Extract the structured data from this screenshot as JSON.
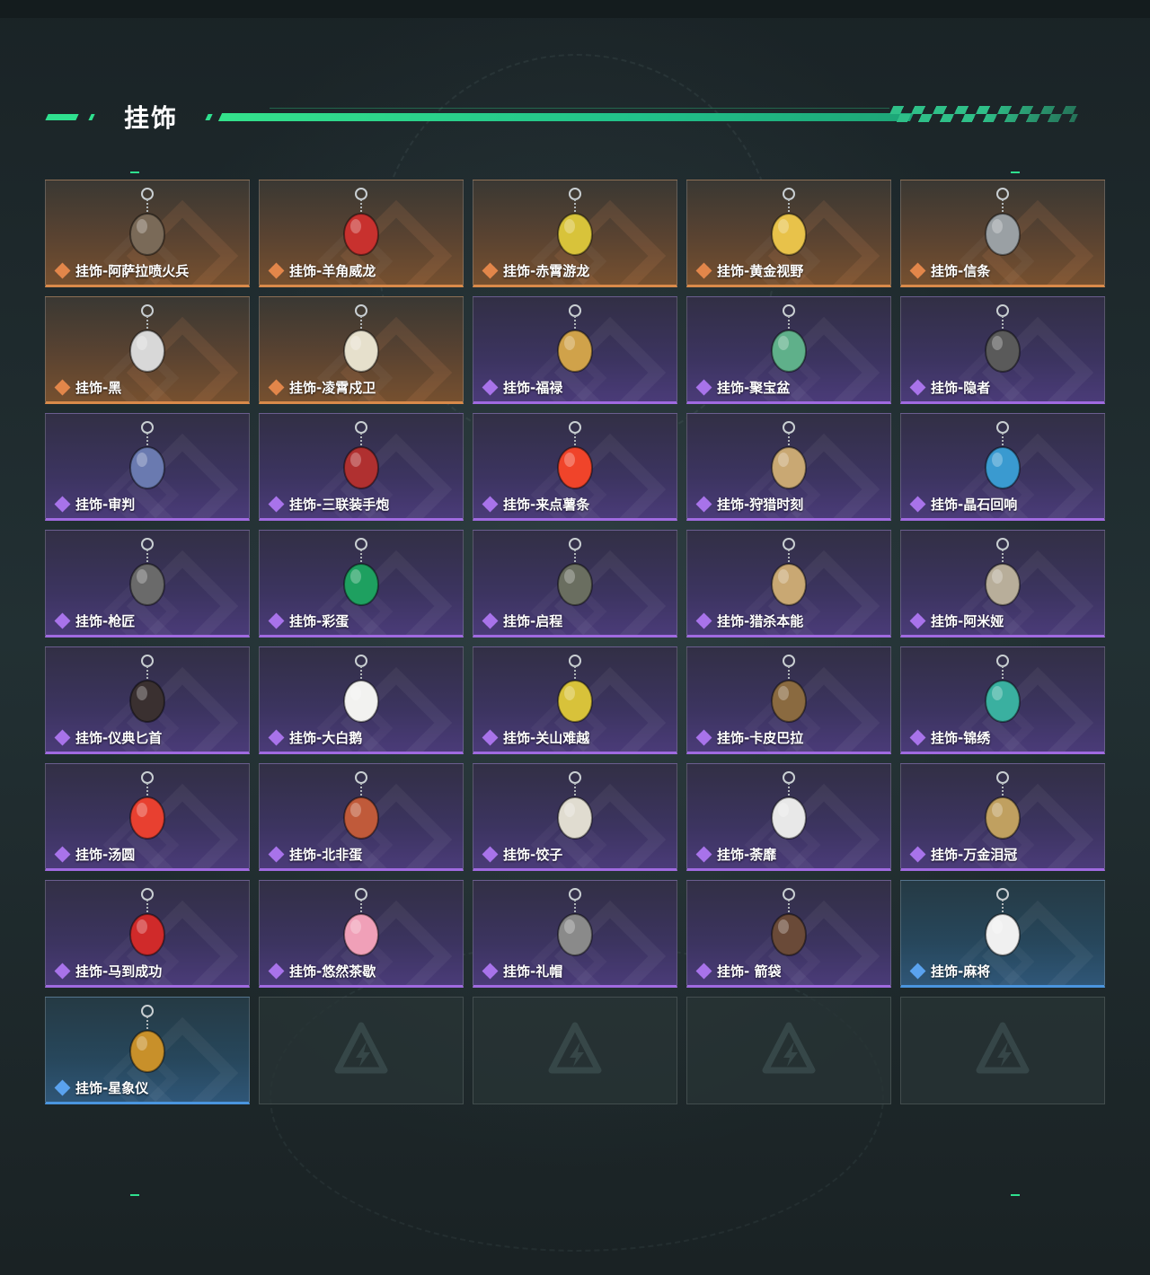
{
  "section": {
    "title": "挂饰"
  },
  "colors": {
    "accent": "#2fe08f",
    "legendary": "#d98a4a",
    "epic": "#a06ae0",
    "rare": "#4a95de"
  },
  "items": [
    {
      "label": "挂饰-阿萨拉喷火兵",
      "rarity": "orange",
      "icon": "soldier-charm-icon",
      "color": "#7a6a58"
    },
    {
      "label": "挂饰-羊角威龙",
      "rarity": "orange",
      "icon": "red-dragon-charm-icon",
      "color": "#c8312e"
    },
    {
      "label": "挂饰-赤霄游龙",
      "rarity": "orange",
      "icon": "yellow-dragon-charm-icon",
      "color": "#d8c33a"
    },
    {
      "label": "挂饰-黄金视野",
      "rarity": "orange",
      "icon": "gold-figure-charm-icon",
      "color": "#e8c24a"
    },
    {
      "label": "挂饰-信条",
      "rarity": "orange",
      "icon": "silver-charm-icon",
      "color": "#9aa0a4"
    },
    {
      "label": "挂饰-黑",
      "rarity": "orange",
      "icon": "card-charm-icon",
      "color": "#d8d8d8"
    },
    {
      "label": "挂饰-凌霄戍卫",
      "rarity": "orange",
      "icon": "eagle-charm-icon",
      "color": "#e6e0cc"
    },
    {
      "label": "挂饰-福禄",
      "rarity": "purple",
      "icon": "gourd-charm-icon",
      "color": "#d0a24a"
    },
    {
      "label": "挂饰-聚宝盆",
      "rarity": "purple",
      "icon": "treasure-bowl-charm-icon",
      "color": "#5fb08a"
    },
    {
      "label": "挂饰-隐者",
      "rarity": "purple",
      "icon": "tarot-card-charm-icon",
      "color": "#5a5a5a"
    },
    {
      "label": "挂饰-审判",
      "rarity": "purple",
      "icon": "judgement-card-charm-icon",
      "color": "#6a7ab0"
    },
    {
      "label": "挂饰-三联装手炮",
      "rarity": "purple",
      "icon": "hand-cannon-charm-icon",
      "color": "#b03030"
    },
    {
      "label": "挂饰-来点薯条",
      "rarity": "purple",
      "icon": "fries-charm-icon",
      "color": "#f0442a"
    },
    {
      "label": "挂饰-狩猎时刻",
      "rarity": "purple",
      "icon": "antler-charm-icon",
      "color": "#c9a873"
    },
    {
      "label": "挂饰-晶石回响",
      "rarity": "purple",
      "icon": "crystal-charm-icon",
      "color": "#3a9ad0"
    },
    {
      "label": "挂饰-枪匠",
      "rarity": "purple",
      "icon": "gunsmith-charm-icon",
      "color": "#6a6a6a"
    },
    {
      "label": "挂饰-彩蛋",
      "rarity": "purple",
      "icon": "green-egg-charm-icon",
      "color": "#1ea060"
    },
    {
      "label": "挂饰-启程",
      "rarity": "purple",
      "icon": "compass-ring-charm-icon",
      "color": "#6a6e60"
    },
    {
      "label": "挂饰-猎杀本能",
      "rarity": "purple",
      "icon": "antler-charm-icon",
      "color": "#c9a873"
    },
    {
      "label": "挂饰-阿米娅",
      "rarity": "purple",
      "icon": "rabbit-ears-charm-icon",
      "color": "#b8ae9a"
    },
    {
      "label": "挂饰-仪典匕首",
      "rarity": "purple",
      "icon": "dagger-charm-icon",
      "color": "#3a3030"
    },
    {
      "label": "挂饰-大白鹅",
      "rarity": "purple",
      "icon": "goose-charm-icon",
      "color": "#f2f2f0"
    },
    {
      "label": "挂饰-关山难越",
      "rarity": "purple",
      "icon": "yellow-can-charm-icon",
      "color": "#d8c23a"
    },
    {
      "label": "挂饰-卡皮巴拉",
      "rarity": "purple",
      "icon": "capybara-charm-icon",
      "color": "#8a6a40"
    },
    {
      "label": "挂饰-锦绣",
      "rarity": "purple",
      "icon": "butterfly-charm-icon",
      "color": "#3ab0a0"
    },
    {
      "label": "挂饰-汤圆",
      "rarity": "purple",
      "icon": "tangyuan-charm-icon",
      "color": "#e84030"
    },
    {
      "label": "挂饰-北非蛋",
      "rarity": "purple",
      "icon": "shakshuka-charm-icon",
      "color": "#c05a3a"
    },
    {
      "label": "挂饰-饺子",
      "rarity": "purple",
      "icon": "dumpling-charm-icon",
      "color": "#e0dcd0"
    },
    {
      "label": "挂饰-荼靡",
      "rarity": "purple",
      "icon": "flower-charm-icon",
      "color": "#e8e8e8"
    },
    {
      "label": "挂饰-万金泪冠",
      "rarity": "purple",
      "icon": "crown-burger-charm-icon",
      "color": "#c0a060"
    },
    {
      "label": "挂饰-马到成功",
      "rarity": "purple",
      "icon": "red-horse-charm-icon",
      "color": "#d02a2a"
    },
    {
      "label": "挂饰-悠然茶歇",
      "rarity": "purple",
      "icon": "cupcake-charm-icon",
      "color": "#f0a0b8"
    },
    {
      "label": "挂饰-礼帽",
      "rarity": "purple",
      "icon": "hat-charm-icon",
      "color": "#8a8a8a"
    },
    {
      "label": "挂饰- 箭袋",
      "rarity": "purple",
      "icon": "quiver-charm-icon",
      "color": "#6a4a38"
    },
    {
      "label": "挂饰-麻将",
      "rarity": "blue",
      "icon": "mahjong-charm-icon",
      "color": "#f0f0f0"
    },
    {
      "label": "挂饰-星象仪",
      "rarity": "blue",
      "icon": "astrolabe-charm-icon",
      "color": "#c8902a"
    },
    {
      "label": "",
      "rarity": "empty",
      "icon": "logo-placeholder-icon",
      "color": ""
    },
    {
      "label": "",
      "rarity": "empty",
      "icon": "logo-placeholder-icon",
      "color": ""
    },
    {
      "label": "",
      "rarity": "empty",
      "icon": "logo-placeholder-icon",
      "color": ""
    },
    {
      "label": "",
      "rarity": "empty",
      "icon": "logo-placeholder-icon",
      "color": ""
    }
  ]
}
